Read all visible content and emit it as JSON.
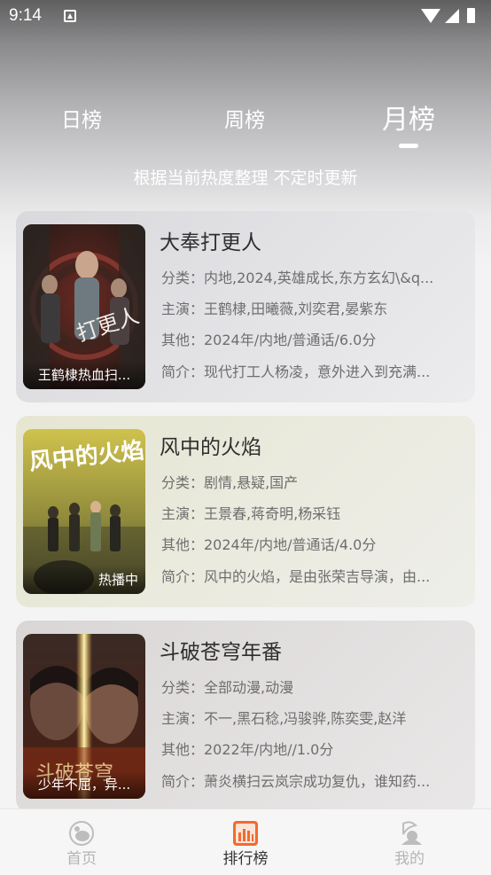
{
  "status_bar": {
    "time": "9:14"
  },
  "tabs": [
    {
      "label": "日榜",
      "active": false
    },
    {
      "label": "周榜",
      "active": false
    },
    {
      "label": "月榜",
      "active": true
    }
  ],
  "subtitle": "根据当前热度整理 不定时更新",
  "cards": [
    {
      "title": "大奉打更人",
      "poster_caption": "王鹤棣热血扫...",
      "category": "分类：内地,2024,英雄成长,东方玄幻\\&q...",
      "cast": "主演：王鹤棣,田曦薇,刘奕君,晏紫东",
      "other": "其他：2024年/内地/普通话/6.0分",
      "intro": "简介：现代打工人杨凌，意外进入到充满..."
    },
    {
      "title": "风中的火焰",
      "poster_caption": "热播中",
      "category": "分类：剧情,悬疑,国产",
      "cast": "主演：王景春,蒋奇明,杨采钰",
      "other": "其他：2024年/内地/普通话/4.0分",
      "intro": "简介：风中的火焰，是由张荣吉导演，由..."
    },
    {
      "title": "斗破苍穹年番",
      "poster_caption": "少年不屈，异...",
      "category": "分类：全部动漫,动漫",
      "cast": "主演：不一,黑石稔,冯骏骅,陈奕雯,赵洋",
      "other": "其他：2022年/内地//1.0分",
      "intro": "简介：萧炎横扫云岚宗成功复仇，谁知药..."
    }
  ],
  "bottom_nav": [
    {
      "label": "首页",
      "icon": "home-icon",
      "active": false
    },
    {
      "label": "排行榜",
      "icon": "ranking-icon",
      "active": true
    },
    {
      "label": "我的",
      "icon": "profile-icon",
      "active": false
    }
  ],
  "colors": {
    "nav_active": "#333333",
    "nav_inactive": "#b4b4b4",
    "ranking_icon_accent": "#f26b2e"
  }
}
